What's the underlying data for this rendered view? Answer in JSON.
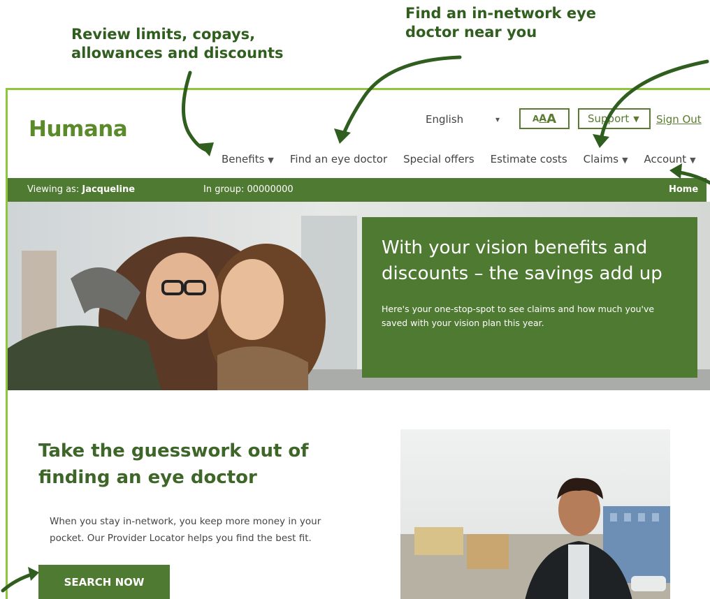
{
  "callouts": {
    "benefits": "Review limits, copays, allowances and discounts",
    "doctor": "Find an in-network eye doctor near you"
  },
  "header": {
    "logo": "Humana",
    "language": "English",
    "text_size": {
      "small": "A",
      "medium": "A",
      "large": "A"
    },
    "support": "Support",
    "sign_out": "Sign Out"
  },
  "nav": {
    "items": [
      {
        "label": "Benefits",
        "has_menu": true
      },
      {
        "label": "Find an eye doctor",
        "has_menu": false
      },
      {
        "label": "Special offers",
        "has_menu": false
      },
      {
        "label": "Estimate costs",
        "has_menu": false
      },
      {
        "label": "Claims",
        "has_menu": true
      },
      {
        "label": "Account",
        "has_menu": true
      }
    ]
  },
  "viewbar": {
    "viewing_label": "Viewing as:",
    "viewing_name": "Jacqueline",
    "group_label": "In group:",
    "group_number": "00000000",
    "home": "Home"
  },
  "hero": {
    "title": "With your vision benefits and discounts – the savings add up",
    "subtitle": "Here's your one-stop-spot to see claims and how much you've saved with your vision plan this year."
  },
  "section": {
    "title": "Take the guesswork out of finding an eye doctor",
    "body": "When you stay in-network, you keep more money in your pocket. Our Provider Locator helps you find the best fit.",
    "button": "SEARCH NOW"
  },
  "colors": {
    "brand_green": "#4f7a32",
    "logo_green": "#5a8a2a",
    "frame_border": "#8ec63f",
    "callout_text": "#2f5e1e"
  },
  "icons": {
    "dropdown": "chevron-down-icon",
    "annotation": "curved-arrow-icon"
  }
}
